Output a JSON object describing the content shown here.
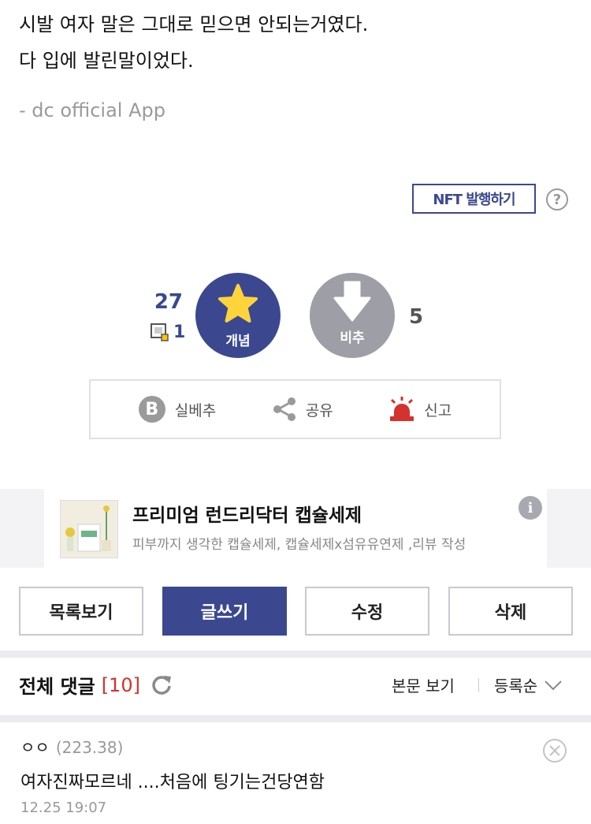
{
  "post": {
    "lines": [
      "시발 여자 말은 그대로 믿으면 안되는거였다.",
      "다 입에 발린말이었다."
    ],
    "signature": "- dc official App"
  },
  "nft": {
    "label": "NFT 발행하기",
    "help_icon": "?"
  },
  "vote": {
    "up_count": "27",
    "fix_count": "1",
    "up_label": "개념",
    "down_label": "비추",
    "down_count": "5"
  },
  "actions": [
    {
      "icon": "b-badge-icon",
      "badge": "B",
      "label": "실베추"
    },
    {
      "icon": "share-icon",
      "label": "공유"
    },
    {
      "icon": "siren-icon",
      "label": "신고"
    }
  ],
  "ad": {
    "title": "프리미엄 런드리닥터 캡슐세제",
    "description": "피부까지 생각한 캡슐세제, 캡슐세제x섬유유연제 ,리뷰 작성",
    "info_icon": "i"
  },
  "buttons": {
    "list": "목록보기",
    "write": "글쓰기",
    "edit": "수정",
    "delete": "삭제"
  },
  "comments": {
    "title": "전체 댓글",
    "count": "[10]",
    "view_body": "본문 보기",
    "sort": "등록순",
    "items": [
      {
        "author": "ㅇㅇ",
        "ip": "(223.38)",
        "text": "여자진짜모르네 ....처음에 팅기는건당연함",
        "date": "12.25 19:07"
      }
    ]
  },
  "colors": {
    "accent": "#3b4890",
    "downvote": "#9e9ea6",
    "alert": "#d3322e",
    "star": "#ffd43b"
  }
}
